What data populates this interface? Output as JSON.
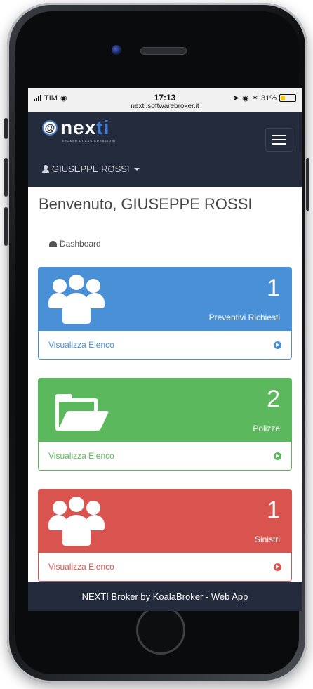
{
  "status_bar": {
    "carrier": "TIM",
    "time": "17:13",
    "url": "nexti.softwarebroker.it",
    "battery": "31%"
  },
  "navbar": {
    "logo_text_main": "nex",
    "logo_text_accent": "ti",
    "logo_subtitle": "BROKER DI ASSICURAZIONI",
    "user_name": "GIUSEPPE ROSSI"
  },
  "page": {
    "welcome": "Benvenuto, GIUSEPPE ROSSI",
    "breadcrumb": "Dashboard"
  },
  "cards": [
    {
      "count": "1",
      "label": "Preventivi Richiesti",
      "link": "Visualizza Elenco",
      "color": "#4a90d6",
      "icon": "users-icon"
    },
    {
      "count": "2",
      "label": "Polizze",
      "link": "Visualizza Elenco",
      "color": "#5cb85c",
      "icon": "folder-open-icon"
    },
    {
      "count": "1",
      "label": "Sinistri",
      "link": "Visualizza Elenco",
      "color": "#d9534f",
      "icon": "users-icon"
    }
  ],
  "footer": {
    "text": "NEXTI Broker by KoalaBroker - Web App"
  }
}
